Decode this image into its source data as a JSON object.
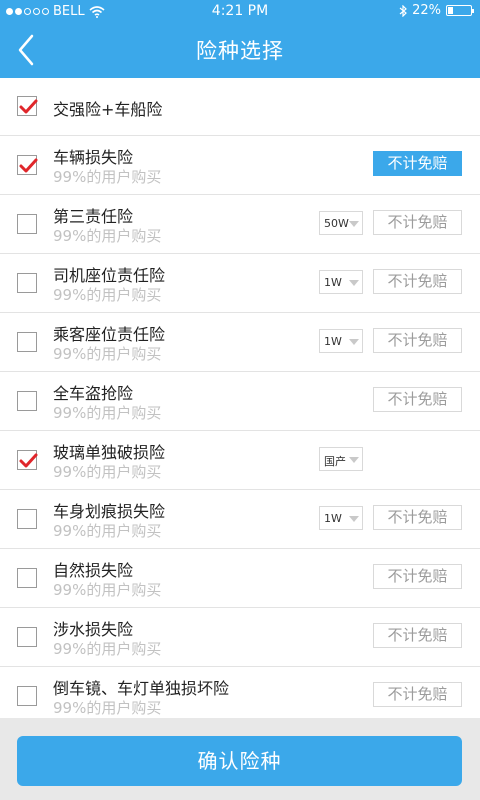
{
  "status_bar": {
    "carrier": "BELL",
    "time": "4:21 PM",
    "battery": "22%",
    "battery_level": 0.22
  },
  "header": {
    "title": "险种选择"
  },
  "items": [
    {
      "name": "交强险+车船险",
      "checked": true
    },
    {
      "name": "车辆损失险",
      "sub": "99%的用户购买",
      "checked": true,
      "button": "不计免赔",
      "button_active": true
    },
    {
      "name": "第三责任险",
      "sub": "99%的用户购买",
      "checked": false,
      "select": "50W",
      "button": "不计免赔",
      "button_active": false
    },
    {
      "name": "司机座位责任险",
      "sub": "99%的用户购买",
      "checked": false,
      "select": "1W",
      "button": "不计免赔",
      "button_active": false
    },
    {
      "name": "乘客座位责任险",
      "sub": "99%的用户购买",
      "checked": false,
      "select": "1W",
      "button": "不计免赔",
      "button_active": false
    },
    {
      "name": "全车盗抢险",
      "sub": "99%的用户购买",
      "checked": false,
      "button": "不计免赔",
      "button_active": false
    },
    {
      "name": "玻璃单独破损险",
      "sub": "99%的用户购买",
      "checked": true,
      "select": "国产"
    },
    {
      "name": "车身划痕损失险",
      "sub": "99%的用户购买",
      "checked": false,
      "select": "1W",
      "button": "不计免赔",
      "button_active": false
    },
    {
      "name": "自然损失险",
      "sub": "99%的用户购买",
      "checked": false,
      "button": "不计免赔",
      "button_active": false
    },
    {
      "name": "涉水损失险",
      "sub": "99%的用户购买",
      "checked": false,
      "button": "不计免赔",
      "button_active": false
    },
    {
      "name": "倒车镜、车灯单独损坏险",
      "sub": "99%的用户购买",
      "checked": false,
      "button": "不计免赔",
      "button_active": false
    }
  ],
  "footer": {
    "confirm_label": "确认险种"
  },
  "colors": {
    "accent": "#3ba8ea",
    "check": "#e0262b"
  }
}
